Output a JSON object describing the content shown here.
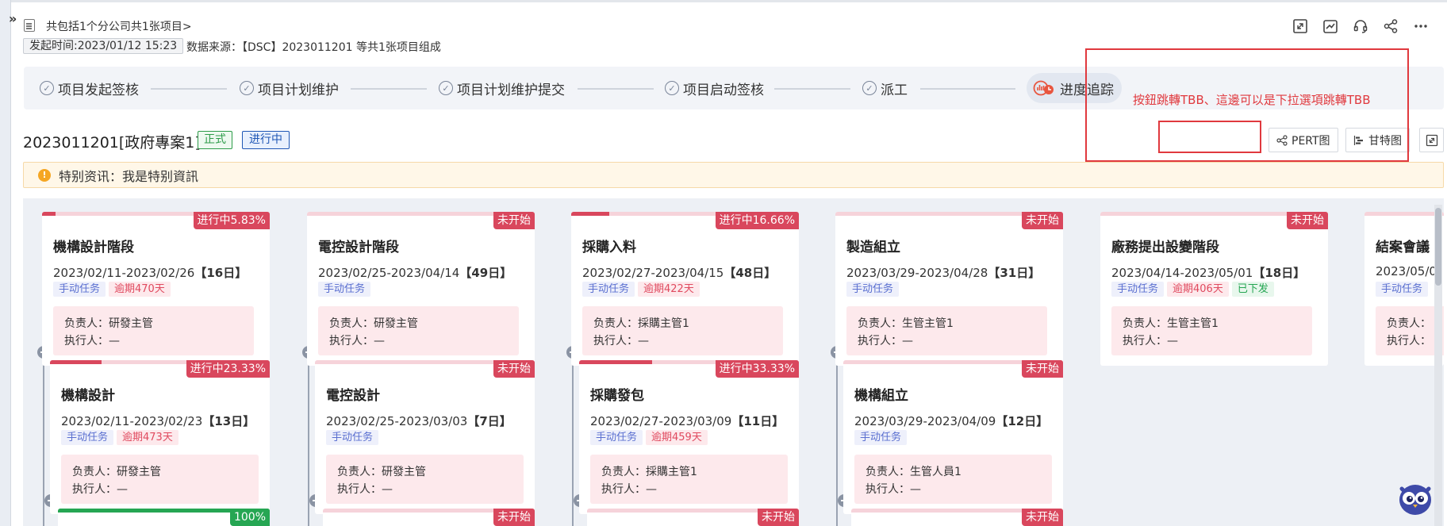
{
  "header": {
    "summary": "共包括1个分公司共1张项目>",
    "start_time": "发起时间:2023/01/12 15:23",
    "data_source": "数据来源：【DSC】2023011201 等共1张项目组成"
  },
  "toolbar": {
    "icons": [
      "expand-icon",
      "chart-icon",
      "headset-icon",
      "share-icon",
      "more-icon"
    ]
  },
  "steps": [
    {
      "label": "项目发起签核"
    },
    {
      "label": "项目计划维护"
    },
    {
      "label": "项目计划维护提交"
    },
    {
      "label": "项目启动签核"
    },
    {
      "label": "派工"
    },
    {
      "label": "进度追踪",
      "active": true
    }
  ],
  "project": {
    "title": "2023011201[政府專案1]",
    "tag_formal": "正式",
    "tag_status": "进行中"
  },
  "buttons": {
    "pert": "PERT图",
    "gantt": "甘特图"
  },
  "annotation": "按鈕跳轉TBB、這邊可以是下拉選項跳轉TBB",
  "notice": "特别资讯：我是特别資訊",
  "stages": [
    {
      "title": "機構設計階段",
      "date": "2023/02/11-2023/02/26",
      "days": "【16日】",
      "badge": "进行中5.83%",
      "progress": 5.83,
      "tags": [
        {
          "t": "手动任务",
          "k": "manual"
        },
        {
          "t": "逾期470天",
          "k": "overdue"
        }
      ],
      "owner": "负责人：研發主管",
      "executor": "执行人：—"
    },
    {
      "title": "電控設計階段",
      "date": "2023/02/25-2023/04/14",
      "days": "【49日】",
      "badge": "未开始",
      "progress": 0,
      "tags": [
        {
          "t": "手动任务",
          "k": "manual"
        }
      ],
      "owner": "负责人：研發主管",
      "executor": "执行人：—"
    },
    {
      "title": "採購入料",
      "date": "2023/02/27-2023/04/15",
      "days": "【48日】",
      "badge": "进行中16.66%",
      "progress": 16.66,
      "tags": [
        {
          "t": "手动任务",
          "k": "manual"
        },
        {
          "t": "逾期422天",
          "k": "overdue"
        }
      ],
      "owner": "负责人：採購主管1",
      "executor": "执行人：—"
    },
    {
      "title": "製造組立",
      "date": "2023/03/29-2023/04/28",
      "days": "【31日】",
      "badge": "未开始",
      "progress": 0,
      "tags": [
        {
          "t": "手动任务",
          "k": "manual"
        }
      ],
      "owner": "负责人：生管主管1",
      "executor": "执行人：—"
    },
    {
      "title": "廠務提出設變階段",
      "date": "2023/04/14-2023/05/01",
      "days": "【18日】",
      "badge": "未开始",
      "progress": 0,
      "tags": [
        {
          "t": "手动任务",
          "k": "manual"
        },
        {
          "t": "逾期406天",
          "k": "overdue"
        },
        {
          "t": "已下发",
          "k": "issued"
        }
      ],
      "owner": "负责人：生管主管1",
      "executor": "执行人：—"
    },
    {
      "title": "結案會議",
      "date": "2023/05/0",
      "days": "",
      "badge": "",
      "progress": 0,
      "tags": [
        {
          "t": "手动任务",
          "k": "manual"
        }
      ],
      "owner": "负责人：",
      "executor": "执行人："
    }
  ],
  "subtasks": [
    {
      "title": "機構設計",
      "date": "2023/02/11-2023/02/23",
      "days": "【13日】",
      "badge": "进行中23.33%",
      "progress": 23.33,
      "tags": [
        {
          "t": "手动任务",
          "k": "manual"
        },
        {
          "t": "逾期473天",
          "k": "overdue"
        }
      ],
      "owner": "负责人：研發主管",
      "executor": "执行人：—"
    },
    {
      "title": "電控設計",
      "date": "2023/02/25-2023/03/03",
      "days": "【7日】",
      "badge": "未开始",
      "progress": 0,
      "tags": [
        {
          "t": "手动任务",
          "k": "manual"
        }
      ],
      "owner": "负责人：研發主管",
      "executor": "执行人：—"
    },
    {
      "title": "採購發包",
      "date": "2023/02/27-2023/03/09",
      "days": "【11日】",
      "badge": "进行中33.33%",
      "progress": 33.33,
      "tags": [
        {
          "t": "手动任务",
          "k": "manual"
        },
        {
          "t": "逾期459天",
          "k": "overdue"
        }
      ],
      "owner": "负责人：採購主管1",
      "executor": "执行人：—"
    },
    {
      "title": "機構組立",
      "date": "2023/03/29-2023/04/09",
      "days": "【12日】",
      "badge": "未开始",
      "progress": 0,
      "tags": [
        {
          "t": "手动任务",
          "k": "manual"
        }
      ],
      "owner": "负责人：生管人員1",
      "executor": "执行人：—"
    }
  ],
  "third_row_badges": [
    "100%",
    "未开始",
    "未开始",
    "未开始"
  ],
  "third_row_progress": [
    100,
    0,
    0,
    0
  ]
}
